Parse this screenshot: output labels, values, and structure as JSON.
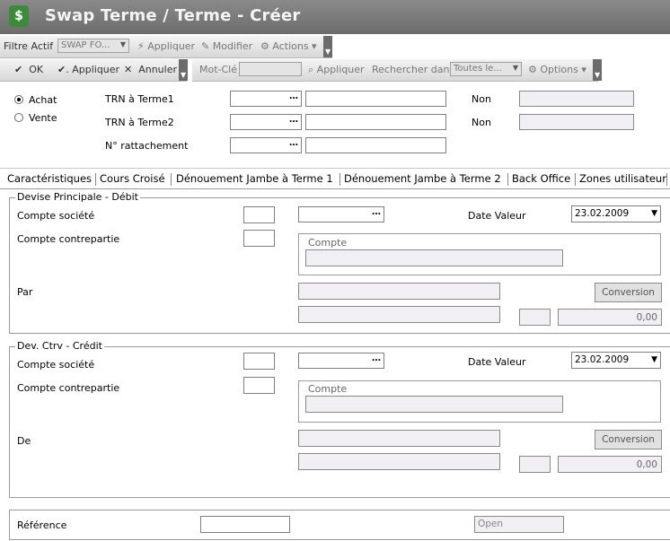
{
  "window": {
    "title": "Swap Terme / Terme - Créer",
    "icon": "app-icon"
  },
  "toolbar1": {
    "filter_label": "Filtre Actif",
    "filter_value": "SWAP FO...",
    "apply": "Appliquer",
    "modify": "Modifier",
    "actions": "Actions"
  },
  "toolbar2": {
    "ok": "OK",
    "apply": "Appliquer",
    "cancel": "Annuler",
    "keyword_label": "Mot-Clé",
    "apply2": "Appliquer",
    "search_in": "Rechercher dans",
    "search_value": "Toutes le...",
    "options": "Options"
  },
  "header": {
    "radio_buy": "Achat",
    "radio_sell": "Vente",
    "selected": "Achat",
    "trn1_label": "TRN à Terme1",
    "trn2_label": "TRN à Terme2",
    "link_label": "N° rattachement",
    "non1": "Non",
    "non2": "Non"
  },
  "tabs": [
    {
      "label": "Caractéristiques",
      "active": false
    },
    {
      "label": "Cours Croisé",
      "active": false
    },
    {
      "label": "Dénouement Jambe à Terme 1",
      "active": true
    },
    {
      "label": "Dénouement Jambe à Terme 2",
      "active": false
    },
    {
      "label": "Back Office",
      "active": false
    },
    {
      "label": "Zones utilisateur",
      "active": false
    }
  ],
  "debit": {
    "title": "Devise Principale - Débit",
    "company_account": "Compte société",
    "counter_account": "Compte contrepartie",
    "value_date_label": "Date Valeur",
    "value_date": "23.02.2009",
    "compte_placeholder": "Compte",
    "par_label": "Par",
    "conversion": "Conversion",
    "amount": "0,00"
  },
  "credit": {
    "title": "Dev. Ctrv - Crédit",
    "company_account": "Compte société",
    "counter_account": "Compte contrepartie",
    "value_date_label": "Date Valeur",
    "value_date": "23.02.2009",
    "compte_placeholder": "Compte",
    "de_label": "De",
    "conversion": "Conversion",
    "amount": "0,00"
  },
  "footer": {
    "reference_label": "Référence",
    "status": "Open"
  },
  "colors": {
    "titlebar": "#7a7a7a",
    "toolbar_grip": "#6b6b6b",
    "field_grey": "#f1eff4"
  }
}
